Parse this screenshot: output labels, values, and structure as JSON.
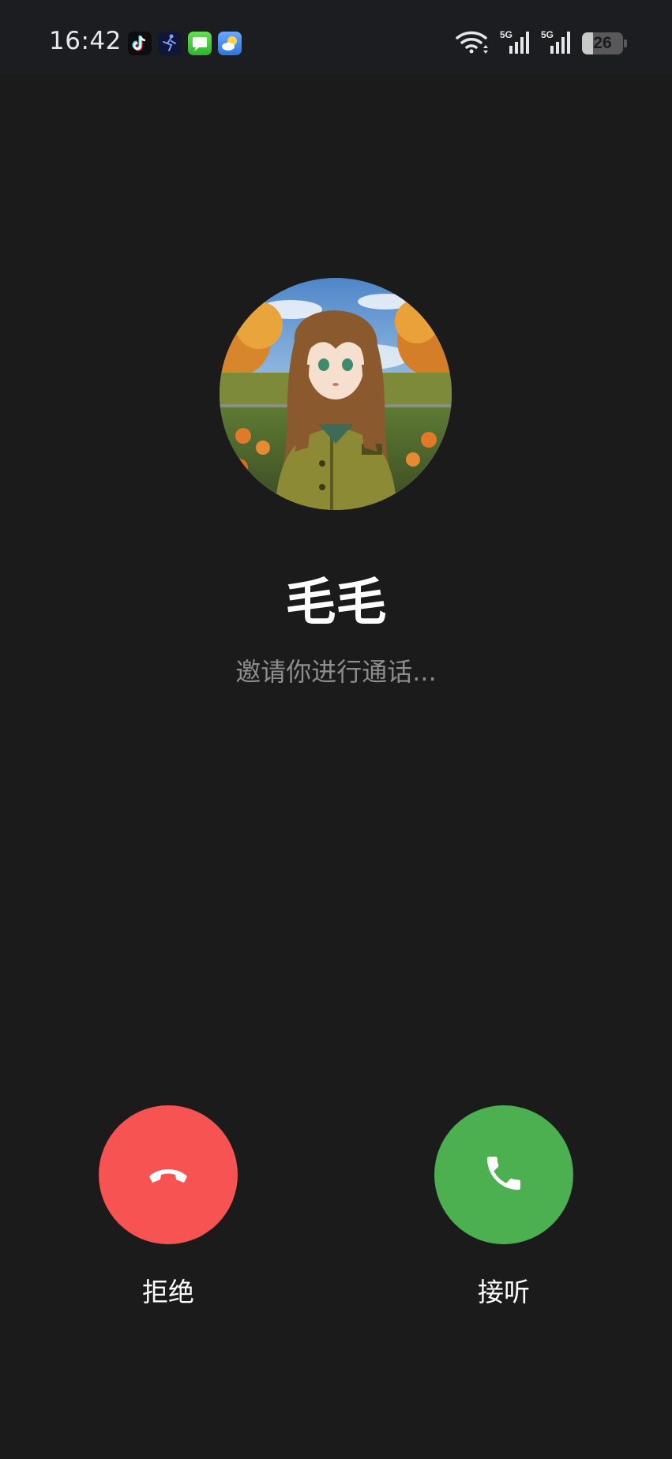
{
  "status_bar": {
    "time": "16:42",
    "notification_icons": [
      "tiktok-icon",
      "fitness-icon",
      "messages-icon",
      "weather-icon"
    ],
    "network_1": "5G",
    "network_2": "5G",
    "battery_level": "26"
  },
  "caller": {
    "name": "毛毛",
    "status": "邀请你进行通话..."
  },
  "actions": {
    "decline_label": "拒绝",
    "accept_label": "接听"
  },
  "colors": {
    "background": "#1b1b1c",
    "decline": "#f65352",
    "accept": "#4caf50"
  }
}
